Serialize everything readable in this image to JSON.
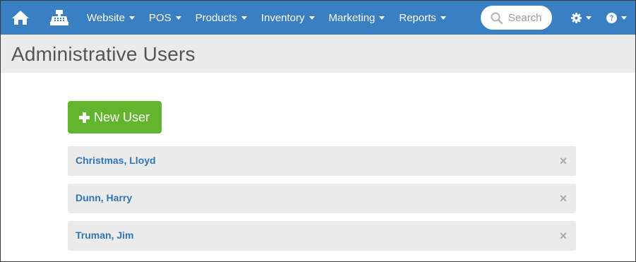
{
  "navbar": {
    "menu": [
      {
        "label": "Website"
      },
      {
        "label": "POS"
      },
      {
        "label": "Products"
      },
      {
        "label": "Inventory"
      },
      {
        "label": "Marketing"
      },
      {
        "label": "Reports"
      }
    ],
    "search_placeholder": "Search",
    "icons": {
      "home": "home-icon",
      "register": "cash-register-icon",
      "search": "search-icon",
      "settings": "gear-icon",
      "help": "question-circle-icon"
    }
  },
  "page": {
    "title": "Administrative Users"
  },
  "actions": {
    "new_user_label": "New User"
  },
  "users": [
    {
      "name": "Christmas, Lloyd"
    },
    {
      "name": "Dunn, Harry"
    },
    {
      "name": "Truman, Jim"
    }
  ],
  "colors": {
    "navbar": "#3a7fc1",
    "header": "#ebebeb",
    "primary_button": "#63b52f",
    "link": "#2e75b6",
    "row_bg": "#ebebeb"
  }
}
